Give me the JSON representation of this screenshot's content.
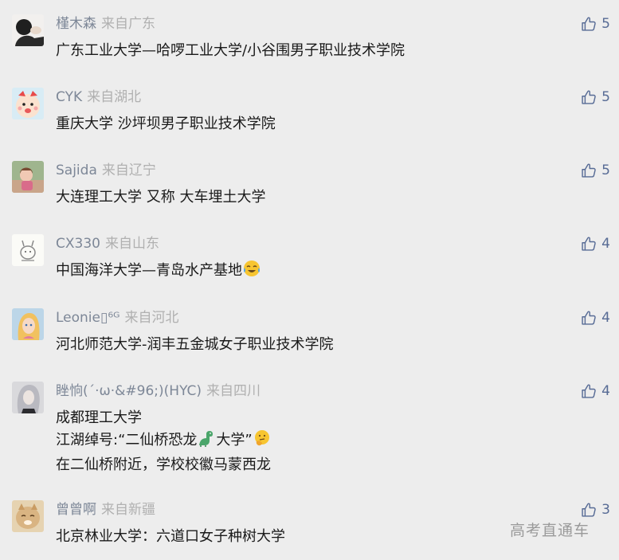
{
  "comments": [
    {
      "name": "槿木森",
      "location": "来自广东",
      "likes": "5",
      "lines": [
        "广东工业大学—哈啰工业大学/小谷围男子职业技术学院"
      ]
    },
    {
      "name": "CYK",
      "location": "来自湖北",
      "likes": "5",
      "lines": [
        "重庆大学 沙坪坝男子职业技术学院"
      ]
    },
    {
      "name": "Sajida",
      "location": "来自辽宁",
      "likes": "5",
      "lines": [
        "大连理工大学 又称 大车埋土大学"
      ]
    },
    {
      "name": "CX330",
      "location": "来自山东",
      "likes": "4",
      "lines": [
        "中国海洋大学—青岛水产基地"
      ]
    },
    {
      "name": "Leonie▯⁶ᴳ",
      "location": "来自河北",
      "likes": "4",
      "lines": [
        "河北师范大学-润丰五金城女子职业技术学院"
      ]
    },
    {
      "name": "睉恦(´·ω·&#96;)(HYC)",
      "location": "来自四川",
      "likes": "4",
      "lines": [
        "成都理工大学",
        "江湖绰号:“二仙桥恐龙",
        "大学”",
        "在二仙桥附近，学校校徽马蒙西龙"
      ]
    },
    {
      "name": "曾曾啊",
      "location": "来自新疆",
      "likes": "3",
      "lines": [
        "北京林业大学：六道口女子种树大学"
      ]
    }
  ],
  "watermark": "高考直通车",
  "icons": {
    "like": "thumbs-up-icon"
  },
  "colors": {
    "name": "#7d8797",
    "location": "#b0b0b0",
    "like": "#576b95",
    "text": "#1a1a1a",
    "background": "#ededed"
  }
}
